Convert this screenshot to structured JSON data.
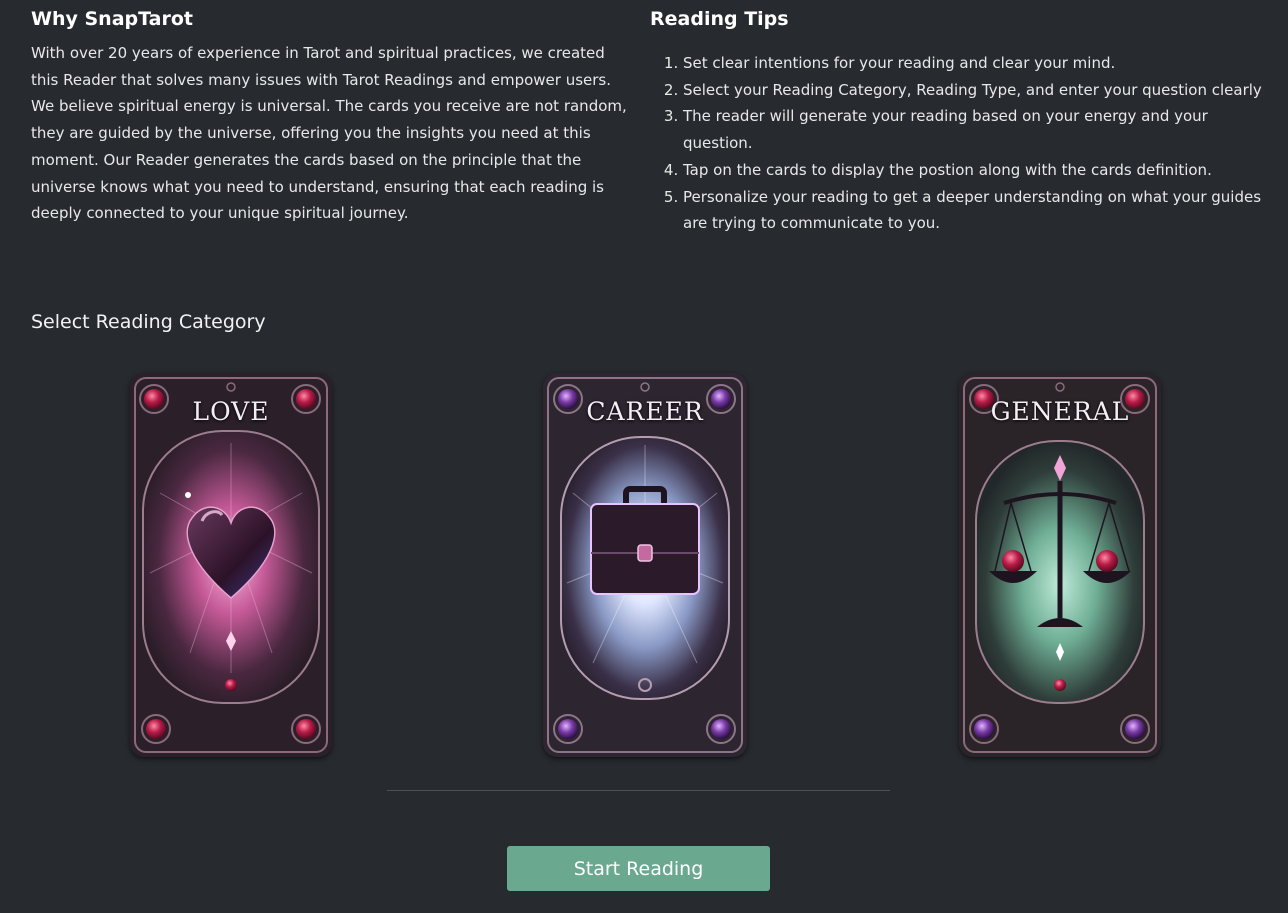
{
  "about": {
    "title": "Why SnapTarot",
    "text": "With over 20 years of experience in Tarot and spiritual practices, we created this Reader that solves many issues with Tarot Readings and empower users. We believe spiritual energy is universal. The cards you receive are not random, they are guided by the universe, offering you the insights you need at this moment. Our Reader generates the cards based on the principle that the universe knows what you need to understand, ensuring that each reading is deeply connected to your unique spiritual journey."
  },
  "tips": {
    "title": "Reading Tips",
    "items": [
      "Set clear intentions for your reading and clear your mind.",
      "Select your Reading Category, Reading Type, and enter your question clearly",
      "The reader will generate your reading based on your energy and your question.",
      "Tap on the cards to display the postion along with the cards definition.",
      "Personalize your reading to get a deeper understanding on what your guides are trying to communicate to you."
    ]
  },
  "category": {
    "title": "Select Reading Category",
    "cards": [
      {
        "label": "LOVE",
        "icon": "heart-icon",
        "accent": "#c0306a",
        "glow": "#e57ab8"
      },
      {
        "label": "CAREER",
        "icon": "briefcase-icon",
        "accent": "#8a4fb0",
        "glow": "#dfe9ff"
      },
      {
        "label": "GENERAL",
        "icon": "scales-icon",
        "accent": "#c0306a",
        "glow": "#7fd1b0"
      }
    ]
  },
  "actions": {
    "start_label": "Start Reading"
  },
  "colors": {
    "background": "#272b30",
    "button": "#6aa98f",
    "card_frame": "#3a2a38"
  }
}
